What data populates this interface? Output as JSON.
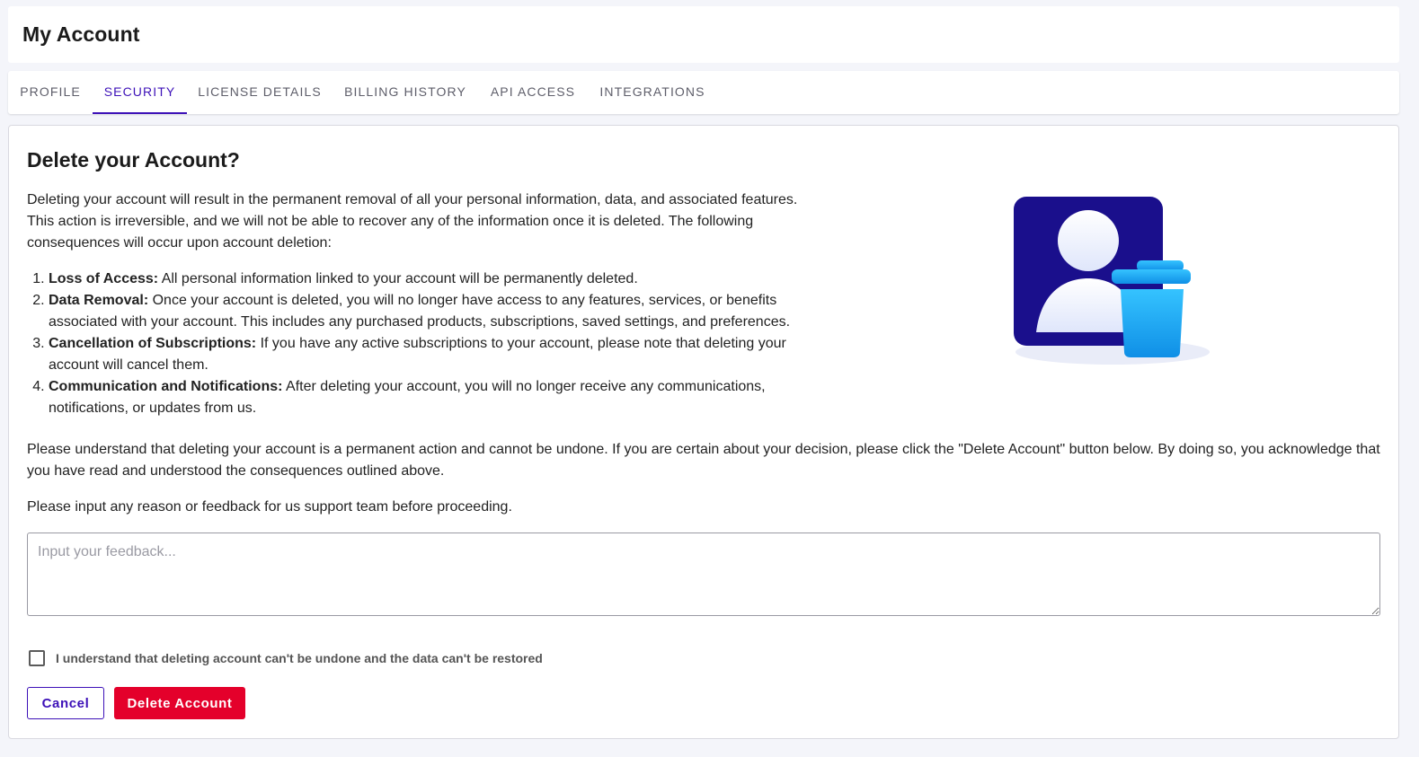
{
  "header": {
    "title": "My Account"
  },
  "tabs": [
    {
      "label": "PROFILE",
      "active": false
    },
    {
      "label": "SECURITY",
      "active": true
    },
    {
      "label": "LICENSE DETAILS",
      "active": false
    },
    {
      "label": "BILLING HISTORY",
      "active": false
    },
    {
      "label": "API ACCESS",
      "active": false
    },
    {
      "label": "INTEGRATIONS",
      "active": false
    }
  ],
  "delete_section": {
    "title": "Delete your Account?",
    "intro": "Deleting your account will result in the permanent removal of all your personal information, data, and associated features. This action is irreversible, and we will not be able to recover any of the information once it is deleted. The following consequences will occur upon account deletion:",
    "consequences": [
      {
        "title": "Loss of Access:",
        "text": " All personal information linked to your account will be permanently deleted."
      },
      {
        "title": "Data Removal:",
        "text": " Once your account is deleted, you will no longer have access to any features, services, or benefits associated with your account. This includes any purchased products, subscriptions, saved settings, and preferences."
      },
      {
        "title": "Cancellation of Subscriptions:",
        "text": " If you have any active subscriptions to your account, please note that deleting your account will cancel them."
      },
      {
        "title": "Communication and Notifications:",
        "text": " After deleting your account, you will no longer receive any communications, notifications, or updates from us."
      }
    ],
    "notice": "Please understand that deleting your account is a permanent action and cannot be undone. If you are certain about your decision, please click the \"Delete Account\" button below. By doing so, you acknowledge that you have read and understood the consequences outlined above.",
    "feedback_prompt": "Please input any reason or feedback for us support team before proceeding.",
    "feedback": {
      "value": "",
      "placeholder": "Input your feedback..."
    },
    "confirm_label": "I understand that deleting account can't be undone and the data can't be restored",
    "confirm_checked": false,
    "cancel_label": "Cancel",
    "delete_label": "Delete Account",
    "illustration_icon": "user-delete-icon"
  },
  "colors": {
    "accent": "#3d11b8",
    "danger": "#e4002b",
    "illustration_dark": "#1a0f8c",
    "illustration_trash": "#1ea7f0"
  }
}
